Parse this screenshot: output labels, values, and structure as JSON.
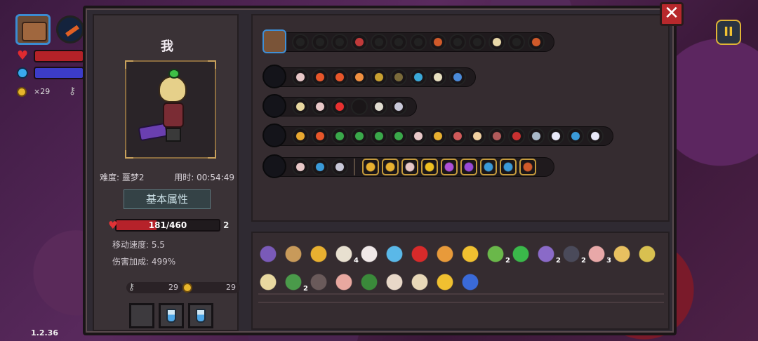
{
  "hud": {
    "coins": "×29",
    "version": "1.2.36",
    "pause_label": "II",
    "close_label": "✕"
  },
  "player": {
    "name": "我",
    "difficulty": "难度: 噩梦2",
    "time": "用时: 00:54:49"
  },
  "stats": {
    "section_title": "基本属性",
    "hp_text": "181/460",
    "hp_fraction": 0.39,
    "hp_side": "2",
    "move_speed": "移动速度: 5.5",
    "damage_bonus": "伤害加成: 499%"
  },
  "resources": {
    "keys": "29",
    "coins": "29"
  },
  "loadout_rows": [
    {
      "head": "chest",
      "chips": [
        {
          "c": "#222"
        },
        {
          "c": "#222"
        },
        {
          "c": "#222"
        },
        {
          "c": "#c03a3a"
        },
        {
          "c": "#222"
        },
        {
          "c": "#222"
        },
        {
          "c": "#222"
        },
        {
          "c": "#d05a2a"
        },
        {
          "c": "#222"
        },
        {
          "c": "#222"
        },
        {
          "c": "#e8d8a8"
        },
        {
          "c": "#222"
        },
        {
          "c": "#d05a2a"
        }
      ]
    },
    {
      "head": "staff-red",
      "chips": [
        {
          "c": "#e8c8c8"
        },
        {
          "c": "#e8562a"
        },
        {
          "c": "#e8562a"
        },
        {
          "c": "#f09040"
        },
        {
          "c": "#c8a030"
        },
        {
          "c": "#7a6a3a"
        },
        {
          "c": "#3aa8d8"
        },
        {
          "c": "#e8e0c0"
        },
        {
          "c": "#4a8ad8"
        }
      ]
    },
    {
      "head": "staff-blue",
      "chips": [
        {
          "c": "#e8d8a0"
        },
        {
          "c": "#e8c8c8"
        },
        {
          "c": "#e83030"
        },
        {
          "c": "#1a1618"
        },
        {
          "c": "#e0dcd0"
        },
        {
          "c": "#c8c8d8"
        }
      ]
    },
    {
      "head": "staff-gray",
      "chips": [
        {
          "c": "#e8a830"
        },
        {
          "c": "#e8562a"
        },
        {
          "c": "#3aa84a"
        },
        {
          "c": "#3aa84a"
        },
        {
          "c": "#3aa84a"
        },
        {
          "c": "#3aa84a"
        },
        {
          "c": "#e8c8c8"
        },
        {
          "c": "#e8b030"
        },
        {
          "c": "#d05a5a"
        },
        {
          "c": "#f0d0a0"
        },
        {
          "c": "#b05a5a"
        },
        {
          "c": "#c83030"
        },
        {
          "c": "#a8b8c8"
        },
        {
          "c": "#e8e8f8"
        },
        {
          "c": "#3a9ad8"
        },
        {
          "c": "#e8e8f8"
        }
      ]
    },
    {
      "head": "tome",
      "chips": [
        {
          "c": "#e8c8c8"
        },
        {
          "c": "#3a9ad8"
        },
        {
          "c": "#c8c8d8"
        }
      ],
      "extra": [
        {
          "c": "#e8b030"
        },
        {
          "c": "#e8b030"
        },
        {
          "c": "#e8c8c8"
        },
        {
          "c": "#f0c020"
        },
        {
          "c": "#b050d8"
        },
        {
          "c": "#9a4ad8"
        },
        {
          "c": "#3a9ad8"
        },
        {
          "c": "#3a9ad8"
        },
        {
          "c": "#d05a2a"
        }
      ]
    }
  ],
  "inventory": {
    "row1": [
      {
        "name": "face-item",
        "c": "#7a5ab8",
        "count": ""
      },
      {
        "name": "seed-item",
        "c": "#c89a5a",
        "count": ""
      },
      {
        "name": "gauntlet-item",
        "c": "#e8b030",
        "count": ""
      },
      {
        "name": "jaw-item",
        "c": "#e8e0d0",
        "count": "4"
      },
      {
        "name": "feather-item",
        "c": "#f0e8e8",
        "count": ""
      },
      {
        "name": "chain-item",
        "c": "#5ab8e8",
        "count": ""
      },
      {
        "name": "red-orb-item",
        "c": "#d82a2a",
        "count": ""
      },
      {
        "name": "scroll-item",
        "c": "#e89a3a",
        "count": ""
      },
      {
        "name": "cup-item",
        "c": "#f0c030",
        "count": ""
      },
      {
        "name": "leaf-item",
        "c": "#6ab84a",
        "count": "2"
      },
      {
        "name": "clover-item",
        "c": "#3ab84a",
        "count": ""
      },
      {
        "name": "beetle-item",
        "c": "#8a6ac8",
        "count": "2"
      },
      {
        "name": "dark-face-item",
        "c": "#4a4a5a",
        "count": "2"
      },
      {
        "name": "pouch-item",
        "c": "#e8a8a8",
        "count": "3"
      },
      {
        "name": "hourglass-item",
        "c": "#e8c060",
        "count": ""
      },
      {
        "name": "gem-item",
        "c": "#d8c050",
        "count": ""
      }
    ],
    "row2": [
      {
        "name": "dumpling-item",
        "c": "#e8d8a0",
        "count": ""
      },
      {
        "name": "green-shoe-item",
        "c": "#4a9a4a",
        "count": "2"
      },
      {
        "name": "spider-item",
        "c": "#6a5a5a",
        "count": ""
      },
      {
        "name": "drumstick-item",
        "c": "#e8a8a0",
        "count": ""
      },
      {
        "name": "boot-item",
        "c": "#3a8a3a",
        "count": ""
      },
      {
        "name": "key-item",
        "c": "#e8d8c8",
        "count": ""
      },
      {
        "name": "magnifier-item",
        "c": "#e8d8b8",
        "count": ""
      },
      {
        "name": "crystal-item",
        "c": "#f0c030",
        "count": ""
      },
      {
        "name": "bottle-item",
        "c": "#3a6ad8",
        "count": ""
      }
    ]
  }
}
